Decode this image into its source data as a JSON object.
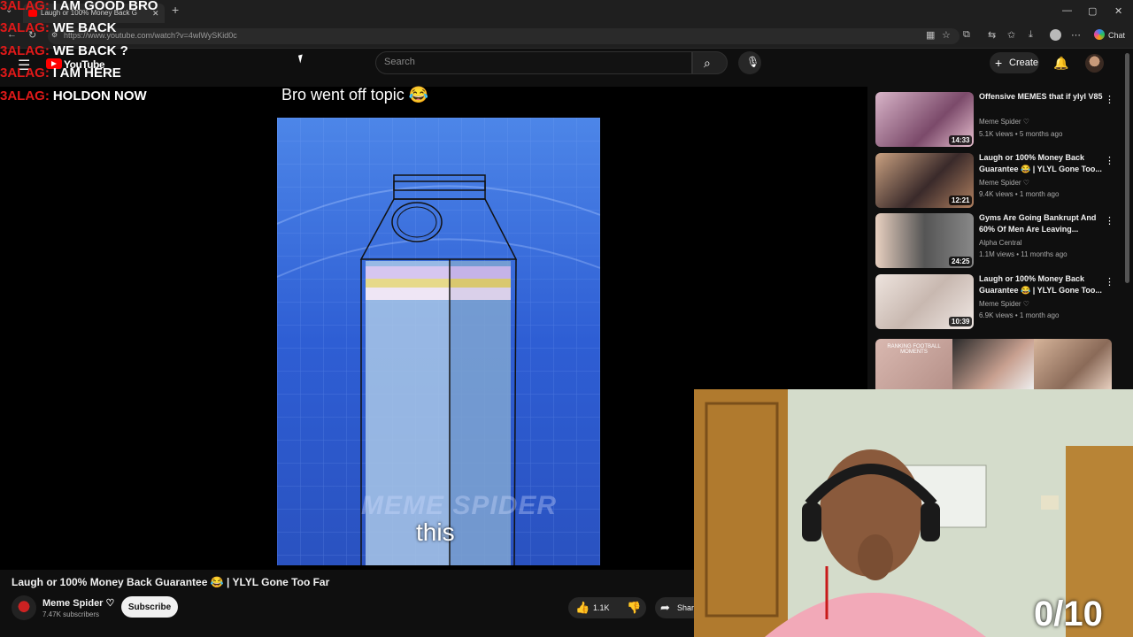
{
  "browser": {
    "tab_title": "Laugh or 100% Money Back G",
    "tab_close": "✕",
    "new_tab": "+",
    "url": "https://www.youtube.com/watch?v=4wlWySKid0c",
    "chat_label": "Chat",
    "window": {
      "minimize": "—",
      "maximize": "▢",
      "close": "✕"
    }
  },
  "header": {
    "logo_text": "YouTube",
    "search_placeholder": "Search",
    "create_label": "Create"
  },
  "stream_chat": [
    {
      "user": "3ALAG:",
      "message": "I AM GOOD BRO"
    },
    {
      "user": "3ALAG:",
      "message": "WE BACK"
    },
    {
      "user": "3ALAG:",
      "message": "WE BACK ?"
    },
    {
      "user": "3ALAG:",
      "message": "I AM HERE"
    },
    {
      "user": "3ALAG:",
      "message": "HOLDON NOW"
    }
  ],
  "video": {
    "overlay_title": "Bro went off topic 😂",
    "caption": "this",
    "watermark": "MEME SPIDER",
    "title": "Laugh or 100% Money Back Guarantee 😂 | YLYL Gone Too Far",
    "channel": "Meme Spider ♡",
    "subscribers": "7.47K subscribers",
    "subscribe_label": "Subscribe",
    "likes": "1.1K",
    "share_label": "Shar"
  },
  "recommended": [
    {
      "title": "Offensive MEMES that if ylyl V85",
      "channel": "Meme Spider ♡",
      "meta": "5.1K views • 5 months ago",
      "duration": "14:33"
    },
    {
      "title": "Laugh or 100% Money Back Guarantee 😂 | YLYL Gone Too...",
      "channel": "Meme Spider ♡",
      "meta": "9.4K views • 1 month ago",
      "duration": "12:21"
    },
    {
      "title": "Gyms Are Going Bankrupt And 60% Of Men Are Leaving...",
      "channel": "Alpha Central",
      "meta": "1.1M views • 11 months ago",
      "duration": "24:25"
    },
    {
      "title": "Laugh or 100% Money Back Guarantee 😂 | YLYL Gone Too...",
      "channel": "Meme Spider ♡",
      "meta": "6.9K views • 1 month ago",
      "duration": "10:39"
    }
  ],
  "shorts_preview_text": "RANKING FOOTBALL MOMENTS",
  "score_overlay": "0/10",
  "colors": {
    "chat_user": "#e01919",
    "bg": "#0f0f0f",
    "video_blue": "#2f5fd6"
  }
}
